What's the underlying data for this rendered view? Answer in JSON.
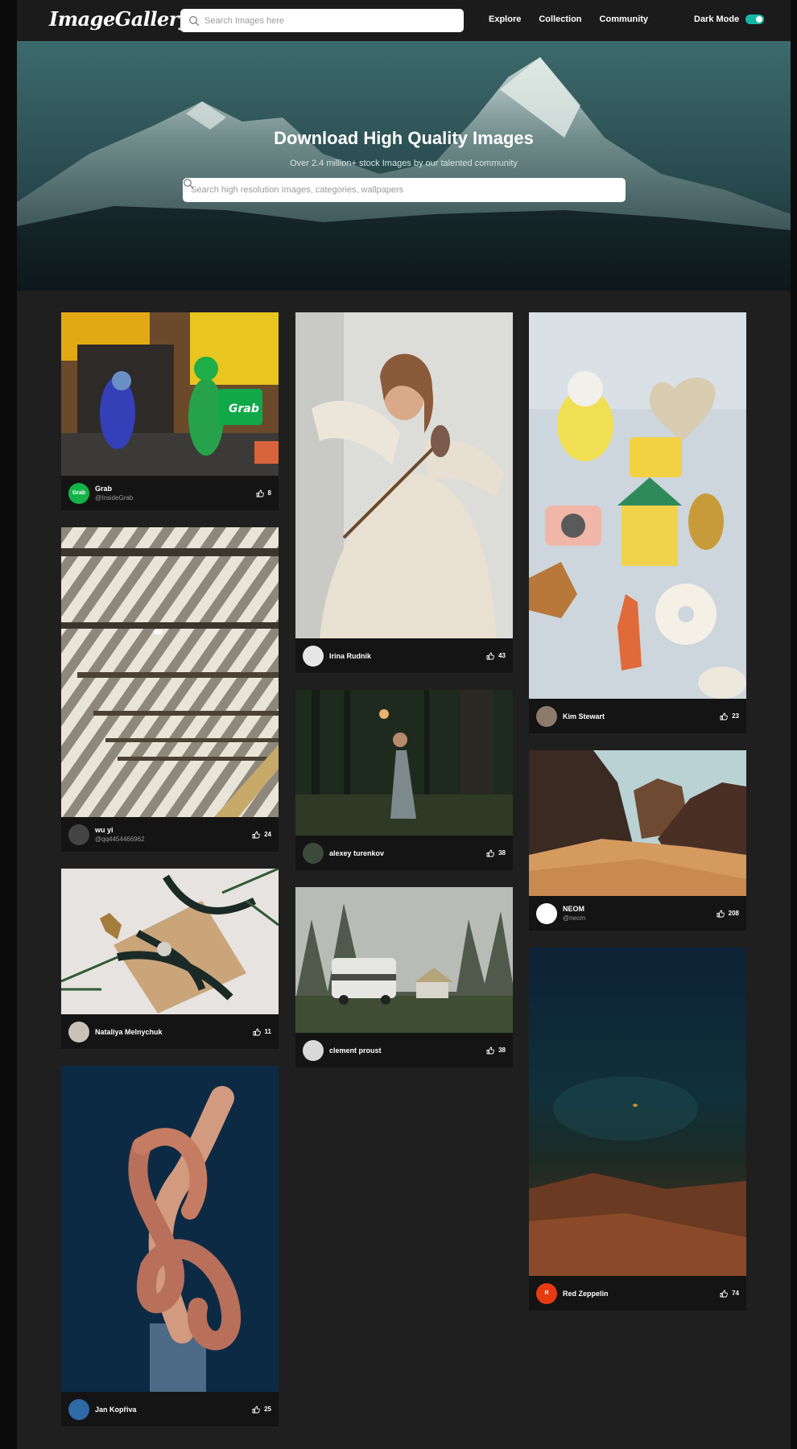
{
  "nav": {
    "logo": "ImageGallery",
    "search_placeholder": "Search Images here",
    "links": [
      "Explore",
      "Collection",
      "Community"
    ],
    "dark_mode_label": "Dark Mode",
    "dark_mode_on": true
  },
  "hero": {
    "title": "Download High Quality Images",
    "subtitle": "Over 2.4 million+ stock Images by our talented community",
    "search_placeholder": "Search high resolution Images, categories, wallpapers"
  },
  "columns": [
    [
      {
        "name": "Grab",
        "handle": "@InsideGrab",
        "likes": "8",
        "avatar": "Grab",
        "avatar_color": "#12b448"
      },
      {
        "name": "wu yi",
        "handle": "@qq4454466962",
        "likes": "24",
        "avatar": "",
        "avatar_color": "#444444"
      },
      {
        "name": "Nataliya Melnychuk",
        "handle": "",
        "likes": "11",
        "avatar": "",
        "avatar_color": "#c9c2b8"
      },
      {
        "name": "Jan Kopřiva",
        "handle": "",
        "likes": "25",
        "avatar": "",
        "avatar_color": "#2d6aa6"
      }
    ],
    [
      {
        "name": "Irina Rudnik",
        "handle": "",
        "likes": "43",
        "avatar": "",
        "avatar_color": "#e6e6e6"
      },
      {
        "name": "alexey turenkov",
        "handle": "",
        "likes": "38",
        "avatar": "",
        "avatar_color": "#3b4a3b"
      },
      {
        "name": "clement proust",
        "handle": "",
        "likes": "38",
        "avatar": "",
        "avatar_color": "#d9d9d9"
      }
    ],
    [
      {
        "name": "Kim Stewart",
        "handle": "",
        "likes": "23",
        "avatar": "",
        "avatar_color": "#8c7a6a"
      },
      {
        "name": "NEOM",
        "handle": "@neom",
        "likes": "208",
        "avatar": "",
        "avatar_color": "#ffffff"
      },
      {
        "name": "Red Zeppelin",
        "handle": "",
        "likes": "74",
        "avatar": "R",
        "avatar_color": "#e63b12"
      }
    ]
  ],
  "icons": {
    "search": "search-icon",
    "like": "thumbs-up-icon",
    "toggle": "toggle-switch"
  },
  "colors": {
    "accent": "#14b8a6",
    "background": "#1f1f1f",
    "card": "#141414"
  }
}
